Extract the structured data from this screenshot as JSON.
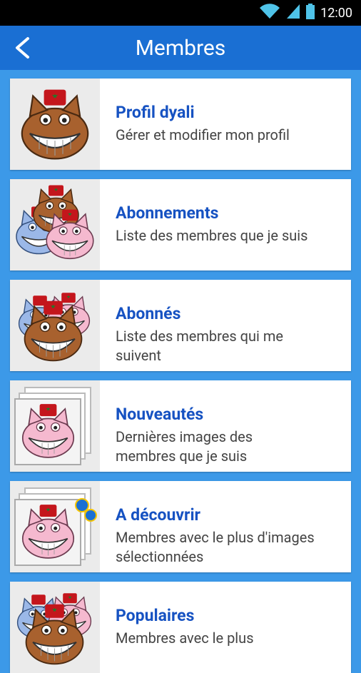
{
  "status_bar": {
    "time": "12:00",
    "icons": [
      "wifi-icon",
      "signal-icon",
      "battery-icon"
    ]
  },
  "app_bar": {
    "title": "Membres",
    "back_icon": "back-arrow-icon"
  },
  "items": [
    {
      "title": "Profil dyali",
      "description": "Gérer et modifier mon profil",
      "avatar": "single-cat-avatar"
    },
    {
      "title": "Abonnements",
      "description": "Liste des membres que je suis",
      "avatar": "cat-group-avatar"
    },
    {
      "title": "Abonnés",
      "description": "Liste des membres qui me suivent",
      "avatar": "cat-group-avatar"
    },
    {
      "title": "Nouveautés",
      "description": "Dernières images des membres que je suis",
      "avatar": "stacked-photos-avatar"
    },
    {
      "title": "A découvrir",
      "description": "Membres avec le plus d'images sélectionnées",
      "avatar": "stacked-photos-avatar"
    },
    {
      "title": "Populaires",
      "description": "Membres avec le plus",
      "avatar": "cat-group-avatar"
    }
  ],
  "colors": {
    "background": "#3c99e8",
    "app_bar": "#1a6fd3",
    "title_text": "#1652c2"
  }
}
